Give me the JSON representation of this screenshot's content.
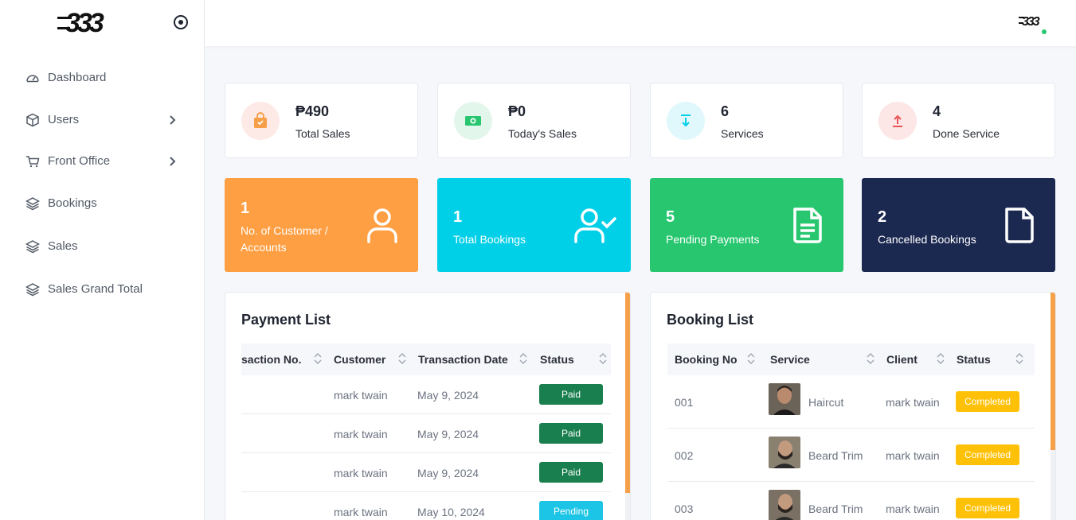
{
  "brand": {
    "logo_text": "333"
  },
  "sidebar": {
    "items": [
      {
        "label": "Dashboard",
        "icon": "dashboard-gauge-icon"
      },
      {
        "label": "Users",
        "icon": "box-icon",
        "has_submenu": true
      },
      {
        "label": "Front Office",
        "icon": "cart-icon",
        "has_submenu": true
      },
      {
        "label": "Bookings",
        "icon": "layers-icon"
      },
      {
        "label": "Sales",
        "icon": "layers-icon"
      },
      {
        "label": "Sales Grand Total",
        "icon": "layers-icon"
      }
    ]
  },
  "stats": [
    {
      "value": "₱490",
      "label": "Total Sales",
      "icon": "shopping-bag-icon",
      "color": "#f7a04a",
      "bg": "#fde9e6"
    },
    {
      "value": "₱0",
      "label": "Today's Sales",
      "icon": "cash-icon",
      "color": "#28c76f",
      "bg": "#e3f6ec"
    },
    {
      "value": "6",
      "label": "Services",
      "icon": "download-icon",
      "color": "#00cfe8",
      "bg": "#e0f8fb"
    },
    {
      "value": "4",
      "label": "Done Service",
      "icon": "upload-icon",
      "color": "#ea5455",
      "bg": "#fde6e6"
    }
  ],
  "summary_cards": [
    {
      "value": "1",
      "label": "No. of Customer / Accounts",
      "icon": "user-icon",
      "color": "#ff9f43"
    },
    {
      "value": "1",
      "label": "Total Bookings",
      "icon": "user-check-icon",
      "color": "#00cfe8"
    },
    {
      "value": "5",
      "label": "Pending Payments",
      "icon": "file-text-icon",
      "color": "#28c76f"
    },
    {
      "value": "2",
      "label": "Cancelled Bookings",
      "icon": "file-icon",
      "color": "#1b2850"
    }
  ],
  "payment_list": {
    "title": "Payment List",
    "columns": [
      "saction No.",
      "Customer",
      "Transaction Date",
      "Status"
    ],
    "rows": [
      {
        "customer": "mark twain",
        "date": "May 9, 2024",
        "status": "Paid"
      },
      {
        "customer": "mark twain",
        "date": "May 9, 2024",
        "status": "Paid"
      },
      {
        "customer": "mark twain",
        "date": "May 9, 2024",
        "status": "Paid"
      },
      {
        "customer": "mark twain",
        "date": "May 10, 2024",
        "status": "Pending"
      }
    ],
    "status_colors": {
      "Paid": "#1a7f4f",
      "Pending": "#1cc5e6"
    }
  },
  "booking_list": {
    "title": "Booking List",
    "columns": [
      "Booking No",
      "Service",
      "Client",
      "Status"
    ],
    "rows": [
      {
        "no": "001",
        "service": "Haircut",
        "client": "mark twain",
        "status": "Completed"
      },
      {
        "no": "002",
        "service": "Beard Trim",
        "client": "mark twain",
        "status": "Completed"
      },
      {
        "no": "003",
        "service": "Beard Trim",
        "client": "mark twain",
        "status": "Completed"
      }
    ],
    "status_color": "#ffc107"
  }
}
